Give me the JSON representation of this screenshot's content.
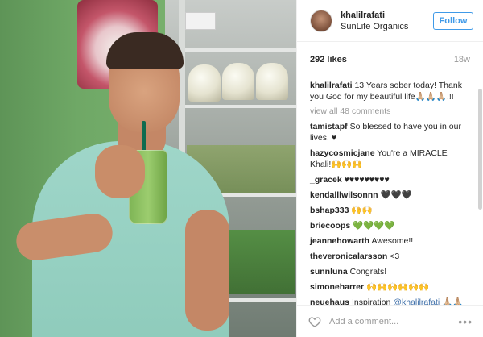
{
  "post": {
    "username": "khalilrafati",
    "location": "SunLife Organics",
    "follow_label": "Follow",
    "likes": "292 likes",
    "age": "18w",
    "add_comment_placeholder": "Add a comment...",
    "more_icon": "more-options-icon",
    "heart_icon": "heart-icon"
  },
  "comments": [
    {
      "user": "khalilrafati",
      "text": "13 Years sober today! Thank you God for my beautiful life🙏🏼🙏🏼🙏🏼!!!"
    },
    {
      "user": "tamistapf",
      "text": "So blessed to have you in our lives! ♥"
    },
    {
      "user": "hazycosmicjane",
      "text": "You're a MIRACLE Khali!🙌🙌🙌"
    },
    {
      "user": "_gracek",
      "text": "♥♥♥♥♥♥♥♥♥"
    },
    {
      "user": "kendalllwilsonnn",
      "text": "🖤🖤🖤"
    },
    {
      "user": "bshap333",
      "text": "🙌🙌"
    },
    {
      "user": "briecoops",
      "text": "💚💚💚💚"
    },
    {
      "user": "jeannehowarth",
      "text": "Awesome!!"
    },
    {
      "user": "theveronicalarsson",
      "text": "<3"
    },
    {
      "user": "sunnluna",
      "text": "Congrats!"
    },
    {
      "user": "simoneharrer",
      "text": "🙌🙌🙌🙌🙌🙌"
    },
    {
      "user": "neuehaus",
      "text": "Inspiration",
      "mention": "@khalilrafati",
      "tail": "🙏🏼🙏🏼🐼 😀"
    }
  ],
  "view_all": "view all 48 comments"
}
